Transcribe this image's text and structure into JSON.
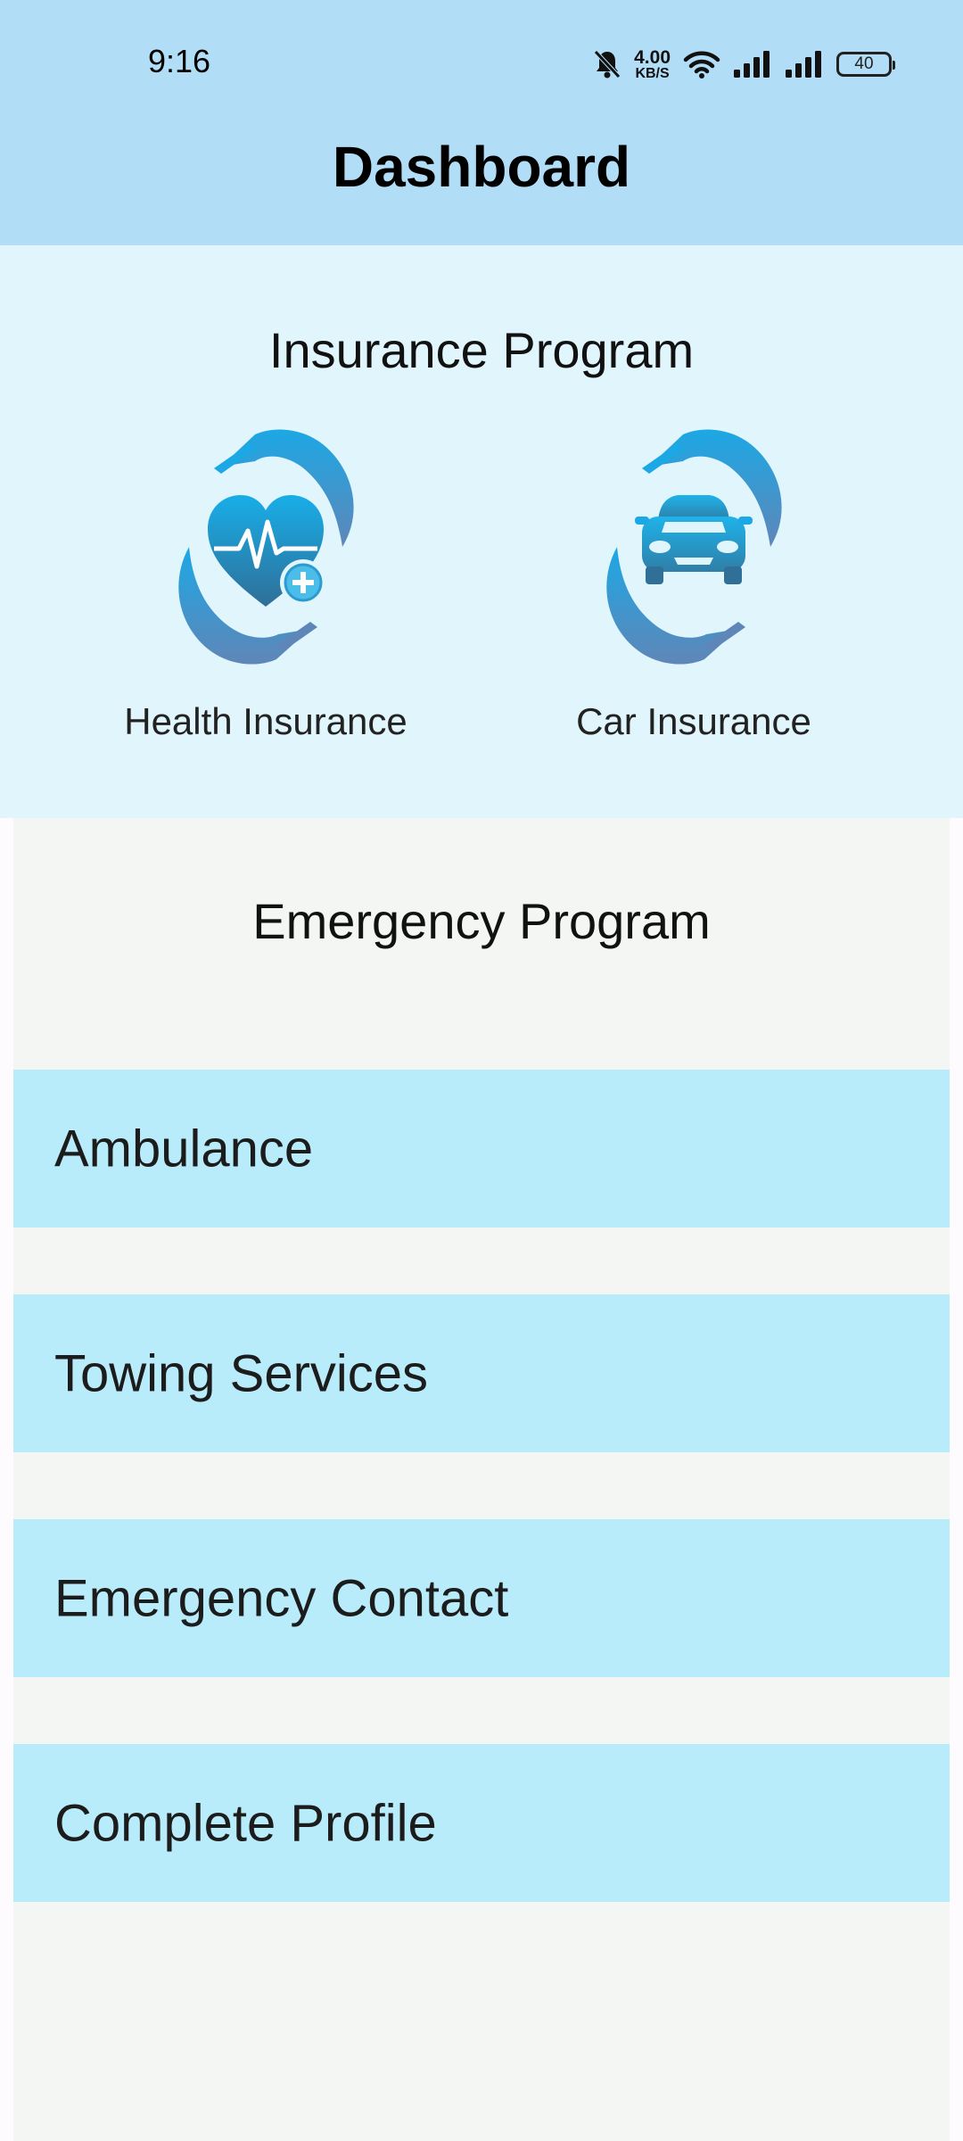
{
  "status_bar": {
    "time": "9:16",
    "net_speed_value": "4.00",
    "net_speed_unit": "KB/S",
    "battery": "40",
    "icons": [
      "bell-off-icon",
      "wifi-icon",
      "signal-icon",
      "signal-icon",
      "battery-icon"
    ]
  },
  "header": {
    "title": "Dashboard"
  },
  "insurance": {
    "title": "Insurance Program",
    "items": [
      {
        "label": "Health Insurance",
        "icon": "health-insurance-icon"
      },
      {
        "label": "Car Insurance",
        "icon": "car-insurance-icon"
      }
    ]
  },
  "emergency": {
    "title": "Emergency Program",
    "items": [
      {
        "label": "Ambulance"
      },
      {
        "label": "Towing Services"
      },
      {
        "label": "Emergency Contact"
      },
      {
        "label": "Complete Profile"
      }
    ]
  },
  "colors": {
    "header_bg": "#b1def6",
    "insurance_bg": "#e0f5fc",
    "emergency_bg": "#f3f6f3",
    "item_bg": "#b8ecfb",
    "icon_gradient_top": "#1ca8e4",
    "icon_gradient_bottom": "#5f86b8"
  }
}
